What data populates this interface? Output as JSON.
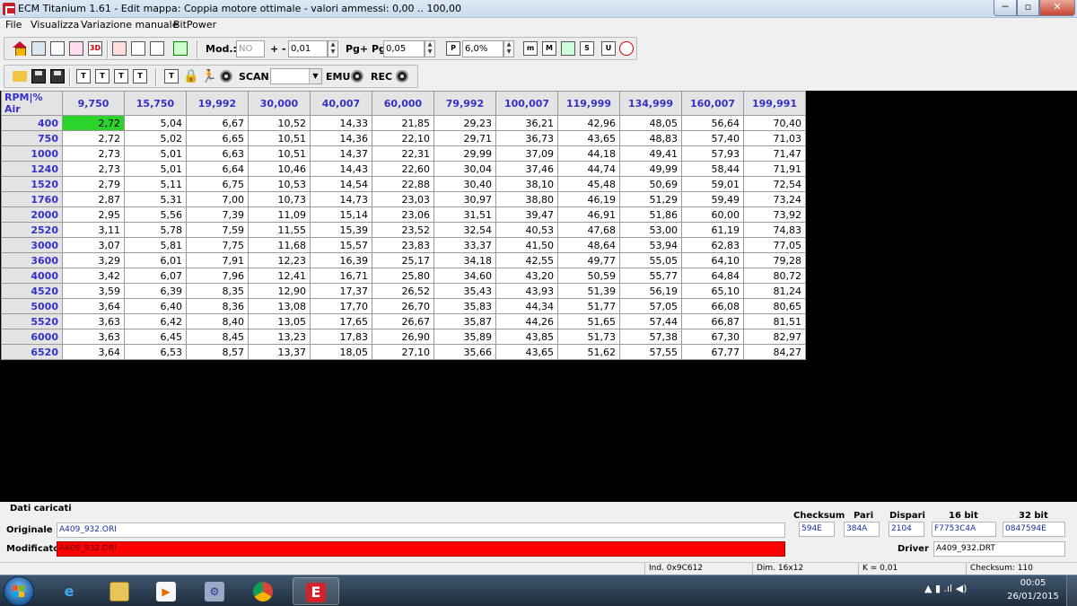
{
  "window": {
    "title": "ECM Titanium 1.61 - Edit mappa: Coppia motore ottimale - valori ammessi: 0,00 .. 100,00",
    "minimize_glyph": "─",
    "maximize_glyph": "▫",
    "close_glyph": "✕"
  },
  "menu": [
    "File",
    "Visualizza",
    "Variazione manuale",
    "BitPower"
  ],
  "toolbar1": {
    "icons_left": [
      "home-icon",
      "copy-map-icon",
      "map-list-icon",
      "graph-icon",
      "3d-view-icon",
      "check-icon",
      "flag-icon",
      "reset-icon",
      "save-green-icon"
    ],
    "icon_texts": {
      "threed": "3D"
    },
    "mod_label": "Mod.:",
    "mod_value": "NO",
    "plusminus_label": "+ -",
    "step_value": "0,01",
    "pg_label": "Pg+ Pg-",
    "pg_value": "0,05",
    "pct_value": "6,0%",
    "right_icon_texts": [
      "m",
      "M",
      "",
      "S",
      "U",
      ""
    ]
  },
  "toolbar2": {
    "icon_texts": [
      "",
      "",
      "",
      "T",
      "T",
      "T",
      "T",
      "T"
    ],
    "scan_label": "SCAN",
    "scan_value": "",
    "emu_label": "EMU",
    "rec_label": "REC"
  },
  "map": {
    "corner_label": "RPM|% Air",
    "columns": [
      "9,750",
      "15,750",
      "19,992",
      "30,000",
      "40,007",
      "60,000",
      "79,992",
      "100,007",
      "119,999",
      "134,999",
      "160,007",
      "199,991"
    ],
    "selected_cell": [
      0,
      0
    ],
    "rows": [
      {
        "rpm": "400",
        "values": [
          "2,72",
          "5,04",
          "6,67",
          "10,52",
          "14,33",
          "21,85",
          "29,23",
          "36,21",
          "42,96",
          "48,05",
          "56,64",
          "70,40"
        ]
      },
      {
        "rpm": "750",
        "values": [
          "2,72",
          "5,02",
          "6,65",
          "10,51",
          "14,36",
          "22,10",
          "29,71",
          "36,73",
          "43,65",
          "48,83",
          "57,40",
          "71,03"
        ]
      },
      {
        "rpm": "1000",
        "values": [
          "2,73",
          "5,01",
          "6,63",
          "10,51",
          "14,37",
          "22,31",
          "29,99",
          "37,09",
          "44,18",
          "49,41",
          "57,93",
          "71,47"
        ]
      },
      {
        "rpm": "1240",
        "values": [
          "2,73",
          "5,01",
          "6,64",
          "10,46",
          "14,43",
          "22,60",
          "30,04",
          "37,46",
          "44,74",
          "49,99",
          "58,44",
          "71,91"
        ]
      },
      {
        "rpm": "1520",
        "values": [
          "2,79",
          "5,11",
          "6,75",
          "10,53",
          "14,54",
          "22,88",
          "30,40",
          "38,10",
          "45,48",
          "50,69",
          "59,01",
          "72,54"
        ]
      },
      {
        "rpm": "1760",
        "values": [
          "2,87",
          "5,31",
          "7,00",
          "10,73",
          "14,73",
          "23,03",
          "30,97",
          "38,80",
          "46,19",
          "51,29",
          "59,49",
          "73,24"
        ]
      },
      {
        "rpm": "2000",
        "values": [
          "2,95",
          "5,56",
          "7,39",
          "11,09",
          "15,14",
          "23,06",
          "31,51",
          "39,47",
          "46,91",
          "51,86",
          "60,00",
          "73,92"
        ]
      },
      {
        "rpm": "2520",
        "values": [
          "3,11",
          "5,78",
          "7,59",
          "11,55",
          "15,39",
          "23,52",
          "32,54",
          "40,53",
          "47,68",
          "53,00",
          "61,19",
          "74,83"
        ]
      },
      {
        "rpm": "3000",
        "values": [
          "3,07",
          "5,81",
          "7,75",
          "11,68",
          "15,57",
          "23,83",
          "33,37",
          "41,50",
          "48,64",
          "53,94",
          "62,83",
          "77,05"
        ]
      },
      {
        "rpm": "3600",
        "values": [
          "3,29",
          "6,01",
          "7,91",
          "12,23",
          "16,39",
          "25,17",
          "34,18",
          "42,55",
          "49,77",
          "55,05",
          "64,10",
          "79,28"
        ]
      },
      {
        "rpm": "4000",
        "values": [
          "3,42",
          "6,07",
          "7,96",
          "12,41",
          "16,71",
          "25,80",
          "34,60",
          "43,20",
          "50,59",
          "55,77",
          "64,84",
          "80,72"
        ]
      },
      {
        "rpm": "4520",
        "values": [
          "3,59",
          "6,39",
          "8,35",
          "12,90",
          "17,37",
          "26,52",
          "35,43",
          "43,93",
          "51,39",
          "56,19",
          "65,10",
          "81,24"
        ]
      },
      {
        "rpm": "5000",
        "values": [
          "3,64",
          "6,40",
          "8,36",
          "13,08",
          "17,70",
          "26,70",
          "35,83",
          "44,34",
          "51,77",
          "57,05",
          "66,08",
          "80,65"
        ]
      },
      {
        "rpm": "5520",
        "values": [
          "3,63",
          "6,42",
          "8,40",
          "13,05",
          "17,65",
          "26,67",
          "35,87",
          "44,26",
          "51,65",
          "57,44",
          "66,87",
          "81,51"
        ]
      },
      {
        "rpm": "6000",
        "values": [
          "3,63",
          "6,45",
          "8,45",
          "13,23",
          "17,83",
          "26,90",
          "35,89",
          "43,85",
          "51,73",
          "57,38",
          "67,30",
          "82,97"
        ]
      },
      {
        "rpm": "6520",
        "values": [
          "3,64",
          "6,53",
          "8,57",
          "13,37",
          "18,05",
          "27,10",
          "35,66",
          "43,65",
          "51,62",
          "57,55",
          "67,77",
          "84,27"
        ]
      }
    ]
  },
  "info": {
    "section_title": "Dati caricati",
    "originale_label": "Originale",
    "originale_file": "A409_932.ORI",
    "modificato_label": "Modificato",
    "modificato_file": "A409_932.ORI",
    "checksum_label": "Checksum",
    "checksum_value": "594E",
    "pari_label": "Pari",
    "pari_value": "384A",
    "dispari_label": "Dispari",
    "dispari_value": "2104",
    "bit16_label": "16 bit",
    "bit16_value": "F7753C4A",
    "bit32_label": "32 bit",
    "bit32_value": "0847594E",
    "driver_label": "Driver",
    "driver_value": "A409_932.DRT"
  },
  "status": {
    "ind": "Ind. 0x9C612",
    "dim": "Dim. 16x12",
    "k": "K = 0,01",
    "checksum": "Checksum: 110"
  },
  "taskbar": {
    "apps": [
      "internet-explorer-icon",
      "file-explorer-icon",
      "media-player-icon",
      "network-tool-icon",
      "chrome-icon",
      "ecm-titanium-icon"
    ],
    "tray_icons": "▲  ▮  .ıl  ◀)",
    "time": "00:05",
    "date": "26/01/2015"
  },
  "colors": {
    "header_text": "#3431c9",
    "selected_cell": "#2bd42b",
    "modified_bar": "#ff0000",
    "grid_background": "#000000"
  }
}
